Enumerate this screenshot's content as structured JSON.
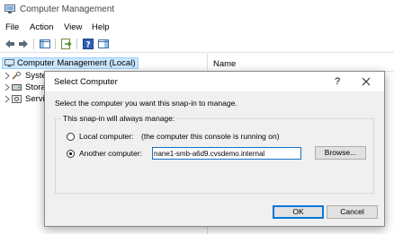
{
  "window": {
    "title": "Computer Management"
  },
  "menu": {
    "items": [
      "File",
      "Action",
      "View",
      "Help"
    ]
  },
  "tree": {
    "root": "Computer Management (Local)",
    "items": [
      "Syste",
      "Stora",
      "Servi"
    ]
  },
  "list": {
    "columns": [
      "Name"
    ]
  },
  "dialog": {
    "title": "Select Computer",
    "help_glyph": "?",
    "intro": "Select the computer you want this snap-in to manage.",
    "group_label": "This snap-in will always manage:",
    "local_label": "Local computer:",
    "local_note": "(the computer this console is running on)",
    "another_label": "Another computer:",
    "computer_value": "nane1-smb-a6d9.cvsdemo.internal",
    "selected_option": "another",
    "browse_label": "Browse...",
    "ok_label": "OK",
    "cancel_label": "Cancel"
  },
  "colors": {
    "selection": "#cce8ff",
    "selection_border": "#99d1ff",
    "dialog_bg": "#f0f0f0",
    "focus_border": "#0078d7"
  }
}
